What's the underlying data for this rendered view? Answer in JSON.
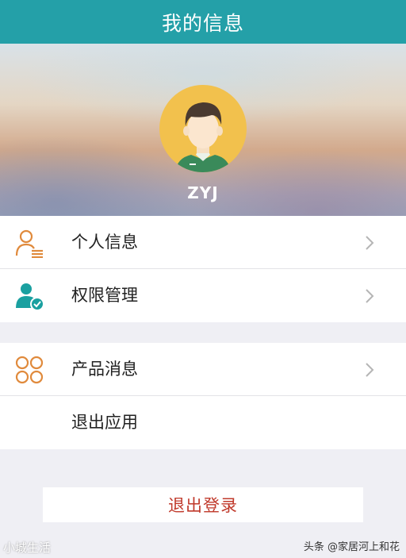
{
  "header": {
    "title": "我的信息"
  },
  "profile": {
    "username": "ZYJ",
    "avatar_icon": "male-avatar-icon"
  },
  "menu_group_1": [
    {
      "label": "个人信息",
      "icon": "user-list-icon",
      "has_chevron": true
    },
    {
      "label": "权限管理",
      "icon": "user-check-icon",
      "has_chevron": true
    }
  ],
  "menu_group_2": [
    {
      "label": "产品消息",
      "icon": "clover-grid-icon",
      "has_chevron": true
    },
    {
      "label": "退出应用",
      "has_chevron": false
    }
  ],
  "logout": {
    "label": "退出登录"
  },
  "watermarks": {
    "left": "小城生活",
    "right": "头条 @家居河上和花"
  },
  "colors": {
    "header_bg": "#24a0a8",
    "avatar_bg": "#f2c14d",
    "icon_orange": "#e08a3c",
    "icon_teal": "#1aa0a0",
    "logout_text": "#c0392b"
  }
}
